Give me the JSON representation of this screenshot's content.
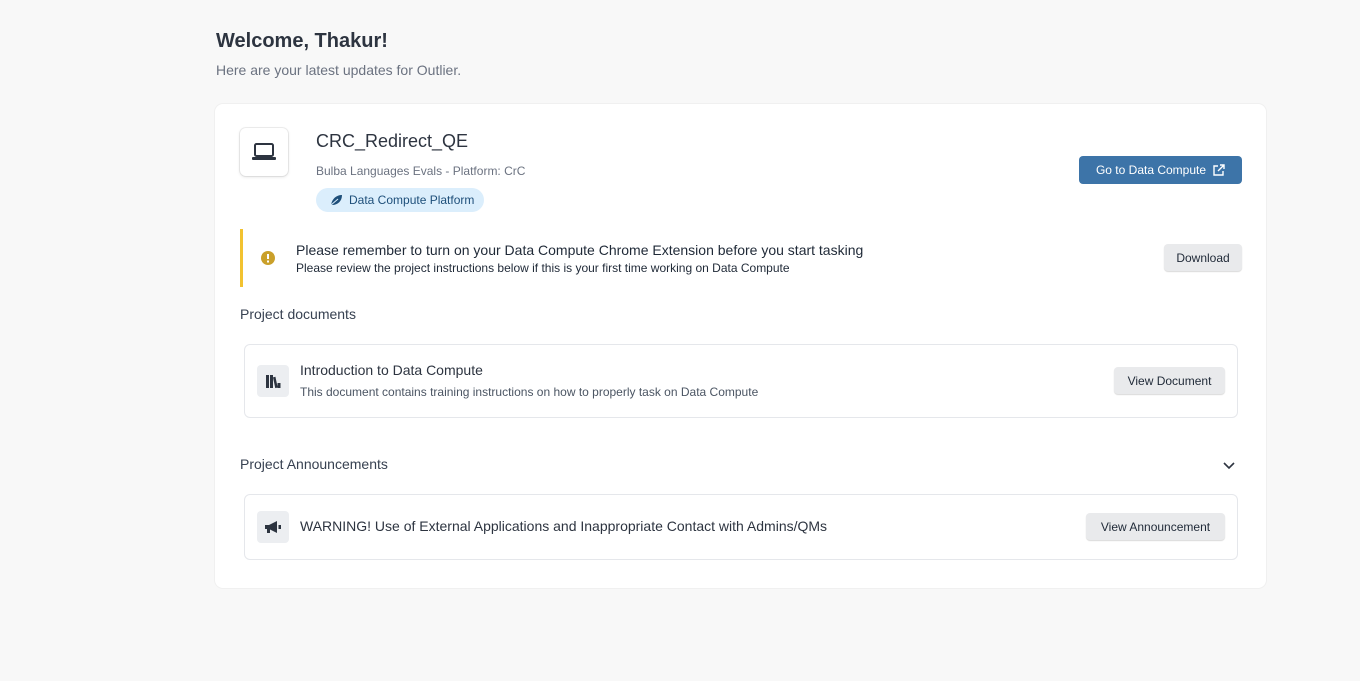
{
  "header": {
    "welcome": "Welcome, Thakur!",
    "subtitle": "Here are your latest updates for Outlier."
  },
  "project": {
    "icon": "laptop-icon",
    "title": "CRC_Redirect_QE",
    "subtitle": "Bulba Languages Evals - Platform: CrC",
    "badge_icon": "leaf-icon",
    "badge": "Data Compute Platform",
    "go_button": "Go to Data Compute",
    "go_button_icon": "external-link-icon"
  },
  "notice": {
    "icon": "warning-circle-icon",
    "title": "Please remember to turn on your Data Compute Chrome Extension before you start tasking",
    "subtitle": "Please review the project instructions below if this is your first time working on Data Compute",
    "button": "Download",
    "accent_color": "#f2c230"
  },
  "documents": {
    "section_title": "Project documents",
    "items": [
      {
        "icon": "books-icon",
        "title": "Introduction to Data Compute",
        "description": "This document contains training instructions on how to properly task on Data Compute",
        "button": "View Document"
      }
    ]
  },
  "announcements": {
    "section_title": "Project Announcements",
    "toggle_icon": "chevron-down-icon",
    "items": [
      {
        "icon": "megaphone-icon",
        "title": "WARNING! Use of External Applications and Inappropriate Contact with Admins/QMs",
        "button": "View Announcement"
      }
    ]
  },
  "colors": {
    "primary_button": "#3d74a8",
    "badge_bg": "#dbeefc"
  }
}
